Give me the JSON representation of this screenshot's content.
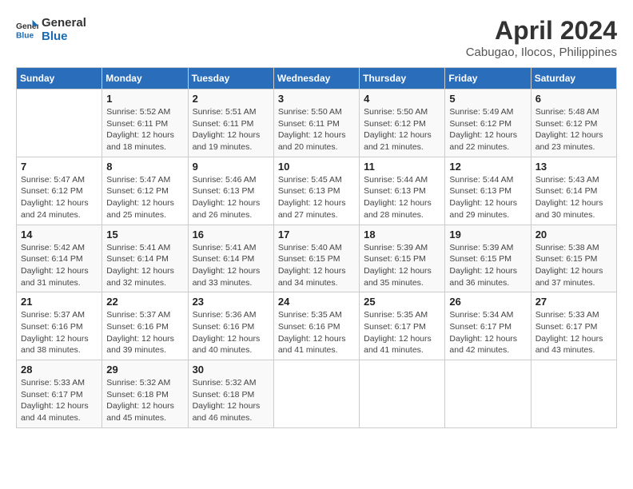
{
  "header": {
    "logo_line1": "General",
    "logo_line2": "Blue",
    "month": "April 2024",
    "location": "Cabugao, Ilocos, Philippines"
  },
  "weekdays": [
    "Sunday",
    "Monday",
    "Tuesday",
    "Wednesday",
    "Thursday",
    "Friday",
    "Saturday"
  ],
  "weeks": [
    [
      {
        "day": "",
        "sunrise": "",
        "sunset": "",
        "daylight": ""
      },
      {
        "day": "1",
        "sunrise": "Sunrise: 5:52 AM",
        "sunset": "Sunset: 6:11 PM",
        "daylight": "Daylight: 12 hours and 18 minutes."
      },
      {
        "day": "2",
        "sunrise": "Sunrise: 5:51 AM",
        "sunset": "Sunset: 6:11 PM",
        "daylight": "Daylight: 12 hours and 19 minutes."
      },
      {
        "day": "3",
        "sunrise": "Sunrise: 5:50 AM",
        "sunset": "Sunset: 6:11 PM",
        "daylight": "Daylight: 12 hours and 20 minutes."
      },
      {
        "day": "4",
        "sunrise": "Sunrise: 5:50 AM",
        "sunset": "Sunset: 6:12 PM",
        "daylight": "Daylight: 12 hours and 21 minutes."
      },
      {
        "day": "5",
        "sunrise": "Sunrise: 5:49 AM",
        "sunset": "Sunset: 6:12 PM",
        "daylight": "Daylight: 12 hours and 22 minutes."
      },
      {
        "day": "6",
        "sunrise": "Sunrise: 5:48 AM",
        "sunset": "Sunset: 6:12 PM",
        "daylight": "Daylight: 12 hours and 23 minutes."
      }
    ],
    [
      {
        "day": "7",
        "sunrise": "Sunrise: 5:47 AM",
        "sunset": "Sunset: 6:12 PM",
        "daylight": "Daylight: 12 hours and 24 minutes."
      },
      {
        "day": "8",
        "sunrise": "Sunrise: 5:47 AM",
        "sunset": "Sunset: 6:12 PM",
        "daylight": "Daylight: 12 hours and 25 minutes."
      },
      {
        "day": "9",
        "sunrise": "Sunrise: 5:46 AM",
        "sunset": "Sunset: 6:13 PM",
        "daylight": "Daylight: 12 hours and 26 minutes."
      },
      {
        "day": "10",
        "sunrise": "Sunrise: 5:45 AM",
        "sunset": "Sunset: 6:13 PM",
        "daylight": "Daylight: 12 hours and 27 minutes."
      },
      {
        "day": "11",
        "sunrise": "Sunrise: 5:44 AM",
        "sunset": "Sunset: 6:13 PM",
        "daylight": "Daylight: 12 hours and 28 minutes."
      },
      {
        "day": "12",
        "sunrise": "Sunrise: 5:44 AM",
        "sunset": "Sunset: 6:13 PM",
        "daylight": "Daylight: 12 hours and 29 minutes."
      },
      {
        "day": "13",
        "sunrise": "Sunrise: 5:43 AM",
        "sunset": "Sunset: 6:14 PM",
        "daylight": "Daylight: 12 hours and 30 minutes."
      }
    ],
    [
      {
        "day": "14",
        "sunrise": "Sunrise: 5:42 AM",
        "sunset": "Sunset: 6:14 PM",
        "daylight": "Daylight: 12 hours and 31 minutes."
      },
      {
        "day": "15",
        "sunrise": "Sunrise: 5:41 AM",
        "sunset": "Sunset: 6:14 PM",
        "daylight": "Daylight: 12 hours and 32 minutes."
      },
      {
        "day": "16",
        "sunrise": "Sunrise: 5:41 AM",
        "sunset": "Sunset: 6:14 PM",
        "daylight": "Daylight: 12 hours and 33 minutes."
      },
      {
        "day": "17",
        "sunrise": "Sunrise: 5:40 AM",
        "sunset": "Sunset: 6:15 PM",
        "daylight": "Daylight: 12 hours and 34 minutes."
      },
      {
        "day": "18",
        "sunrise": "Sunrise: 5:39 AM",
        "sunset": "Sunset: 6:15 PM",
        "daylight": "Daylight: 12 hours and 35 minutes."
      },
      {
        "day": "19",
        "sunrise": "Sunrise: 5:39 AM",
        "sunset": "Sunset: 6:15 PM",
        "daylight": "Daylight: 12 hours and 36 minutes."
      },
      {
        "day": "20",
        "sunrise": "Sunrise: 5:38 AM",
        "sunset": "Sunset: 6:15 PM",
        "daylight": "Daylight: 12 hours and 37 minutes."
      }
    ],
    [
      {
        "day": "21",
        "sunrise": "Sunrise: 5:37 AM",
        "sunset": "Sunset: 6:16 PM",
        "daylight": "Daylight: 12 hours and 38 minutes."
      },
      {
        "day": "22",
        "sunrise": "Sunrise: 5:37 AM",
        "sunset": "Sunset: 6:16 PM",
        "daylight": "Daylight: 12 hours and 39 minutes."
      },
      {
        "day": "23",
        "sunrise": "Sunrise: 5:36 AM",
        "sunset": "Sunset: 6:16 PM",
        "daylight": "Daylight: 12 hours and 40 minutes."
      },
      {
        "day": "24",
        "sunrise": "Sunrise: 5:35 AM",
        "sunset": "Sunset: 6:16 PM",
        "daylight": "Daylight: 12 hours and 41 minutes."
      },
      {
        "day": "25",
        "sunrise": "Sunrise: 5:35 AM",
        "sunset": "Sunset: 6:17 PM",
        "daylight": "Daylight: 12 hours and 41 minutes."
      },
      {
        "day": "26",
        "sunrise": "Sunrise: 5:34 AM",
        "sunset": "Sunset: 6:17 PM",
        "daylight": "Daylight: 12 hours and 42 minutes."
      },
      {
        "day": "27",
        "sunrise": "Sunrise: 5:33 AM",
        "sunset": "Sunset: 6:17 PM",
        "daylight": "Daylight: 12 hours and 43 minutes."
      }
    ],
    [
      {
        "day": "28",
        "sunrise": "Sunrise: 5:33 AM",
        "sunset": "Sunset: 6:17 PM",
        "daylight": "Daylight: 12 hours and 44 minutes."
      },
      {
        "day": "29",
        "sunrise": "Sunrise: 5:32 AM",
        "sunset": "Sunset: 6:18 PM",
        "daylight": "Daylight: 12 hours and 45 minutes."
      },
      {
        "day": "30",
        "sunrise": "Sunrise: 5:32 AM",
        "sunset": "Sunset: 6:18 PM",
        "daylight": "Daylight: 12 hours and 46 minutes."
      },
      {
        "day": "",
        "sunrise": "",
        "sunset": "",
        "daylight": ""
      },
      {
        "day": "",
        "sunrise": "",
        "sunset": "",
        "daylight": ""
      },
      {
        "day": "",
        "sunrise": "",
        "sunset": "",
        "daylight": ""
      },
      {
        "day": "",
        "sunrise": "",
        "sunset": "",
        "daylight": ""
      }
    ]
  ]
}
